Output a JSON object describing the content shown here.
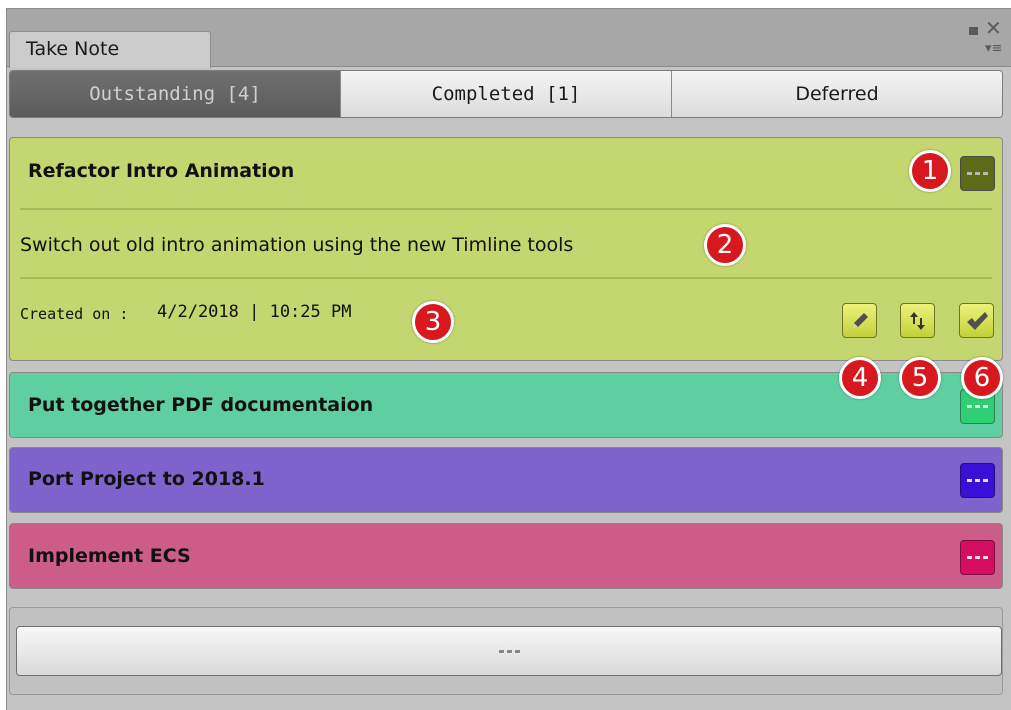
{
  "window": {
    "tab_title": "Take Note"
  },
  "toolbar": {
    "tabs": [
      {
        "label": "Outstanding [4]",
        "active": true
      },
      {
        "label": "Completed [1]",
        "active": false
      },
      {
        "label": "Deferred",
        "active": false
      }
    ]
  },
  "notes": [
    {
      "title": "Refactor Intro Animation",
      "description": "Switch out old intro animation using the new Timline tools",
      "created_label": "Created on :",
      "created_value": "4/2/2018 | 10:25 PM",
      "color": "#c3d66f",
      "expanded": true
    },
    {
      "title": "Put together PDF documentaion",
      "color": "#5fcfa1",
      "expanded": false
    },
    {
      "title": "Port Project to 2018.1",
      "color": "#7f63cc",
      "expanded": false
    },
    {
      "title": "Implement ECS",
      "color": "#cb5d88",
      "expanded": false
    }
  ],
  "icons": {
    "edit": "pencil-icon",
    "reorder": "reorder-arrows-icon",
    "complete": "checkmark-icon",
    "menu": "dots-menu-icon"
  },
  "callouts": [
    "1",
    "2",
    "3",
    "4",
    "5",
    "6"
  ]
}
